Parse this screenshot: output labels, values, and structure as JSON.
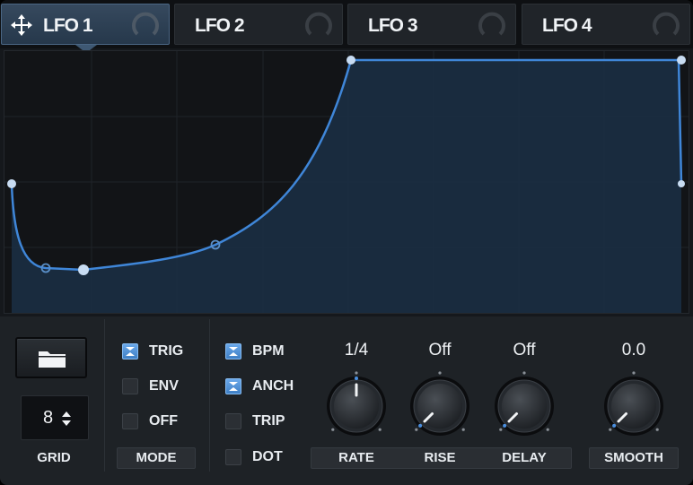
{
  "tabs": [
    {
      "label": "LFO 1",
      "active": true
    },
    {
      "label": "LFO 2",
      "active": false
    },
    {
      "label": "LFO 3",
      "active": false
    },
    {
      "label": "LFO 4",
      "active": false
    }
  ],
  "colors": {
    "accent": "#4a8fe0",
    "curve": "#3f86d8",
    "fill": "#1b2f44",
    "panel": "#1e2226"
  },
  "grid": {
    "value": "8",
    "label": "GRID"
  },
  "mode": {
    "label": "MODE",
    "options": [
      {
        "label": "TRIG",
        "checked": true
      },
      {
        "label": "ENV",
        "checked": false
      },
      {
        "label": "OFF",
        "checked": false
      }
    ]
  },
  "timing": {
    "options": [
      {
        "label": "BPM",
        "checked": true
      },
      {
        "label": "ANCH",
        "checked": true
      },
      {
        "label": "TRIP",
        "checked": false
      },
      {
        "label": "DOT",
        "checked": false
      }
    ]
  },
  "knobs": [
    {
      "label": "RATE",
      "value": "1/4",
      "amount": 0.5
    },
    {
      "label": "RISE",
      "value": "Off",
      "amount": 0.0
    },
    {
      "label": "DELAY",
      "value": "Off",
      "amount": 0.0
    },
    {
      "label": "SMOOTH",
      "value": "0.0",
      "amount": 0.0
    }
  ]
}
